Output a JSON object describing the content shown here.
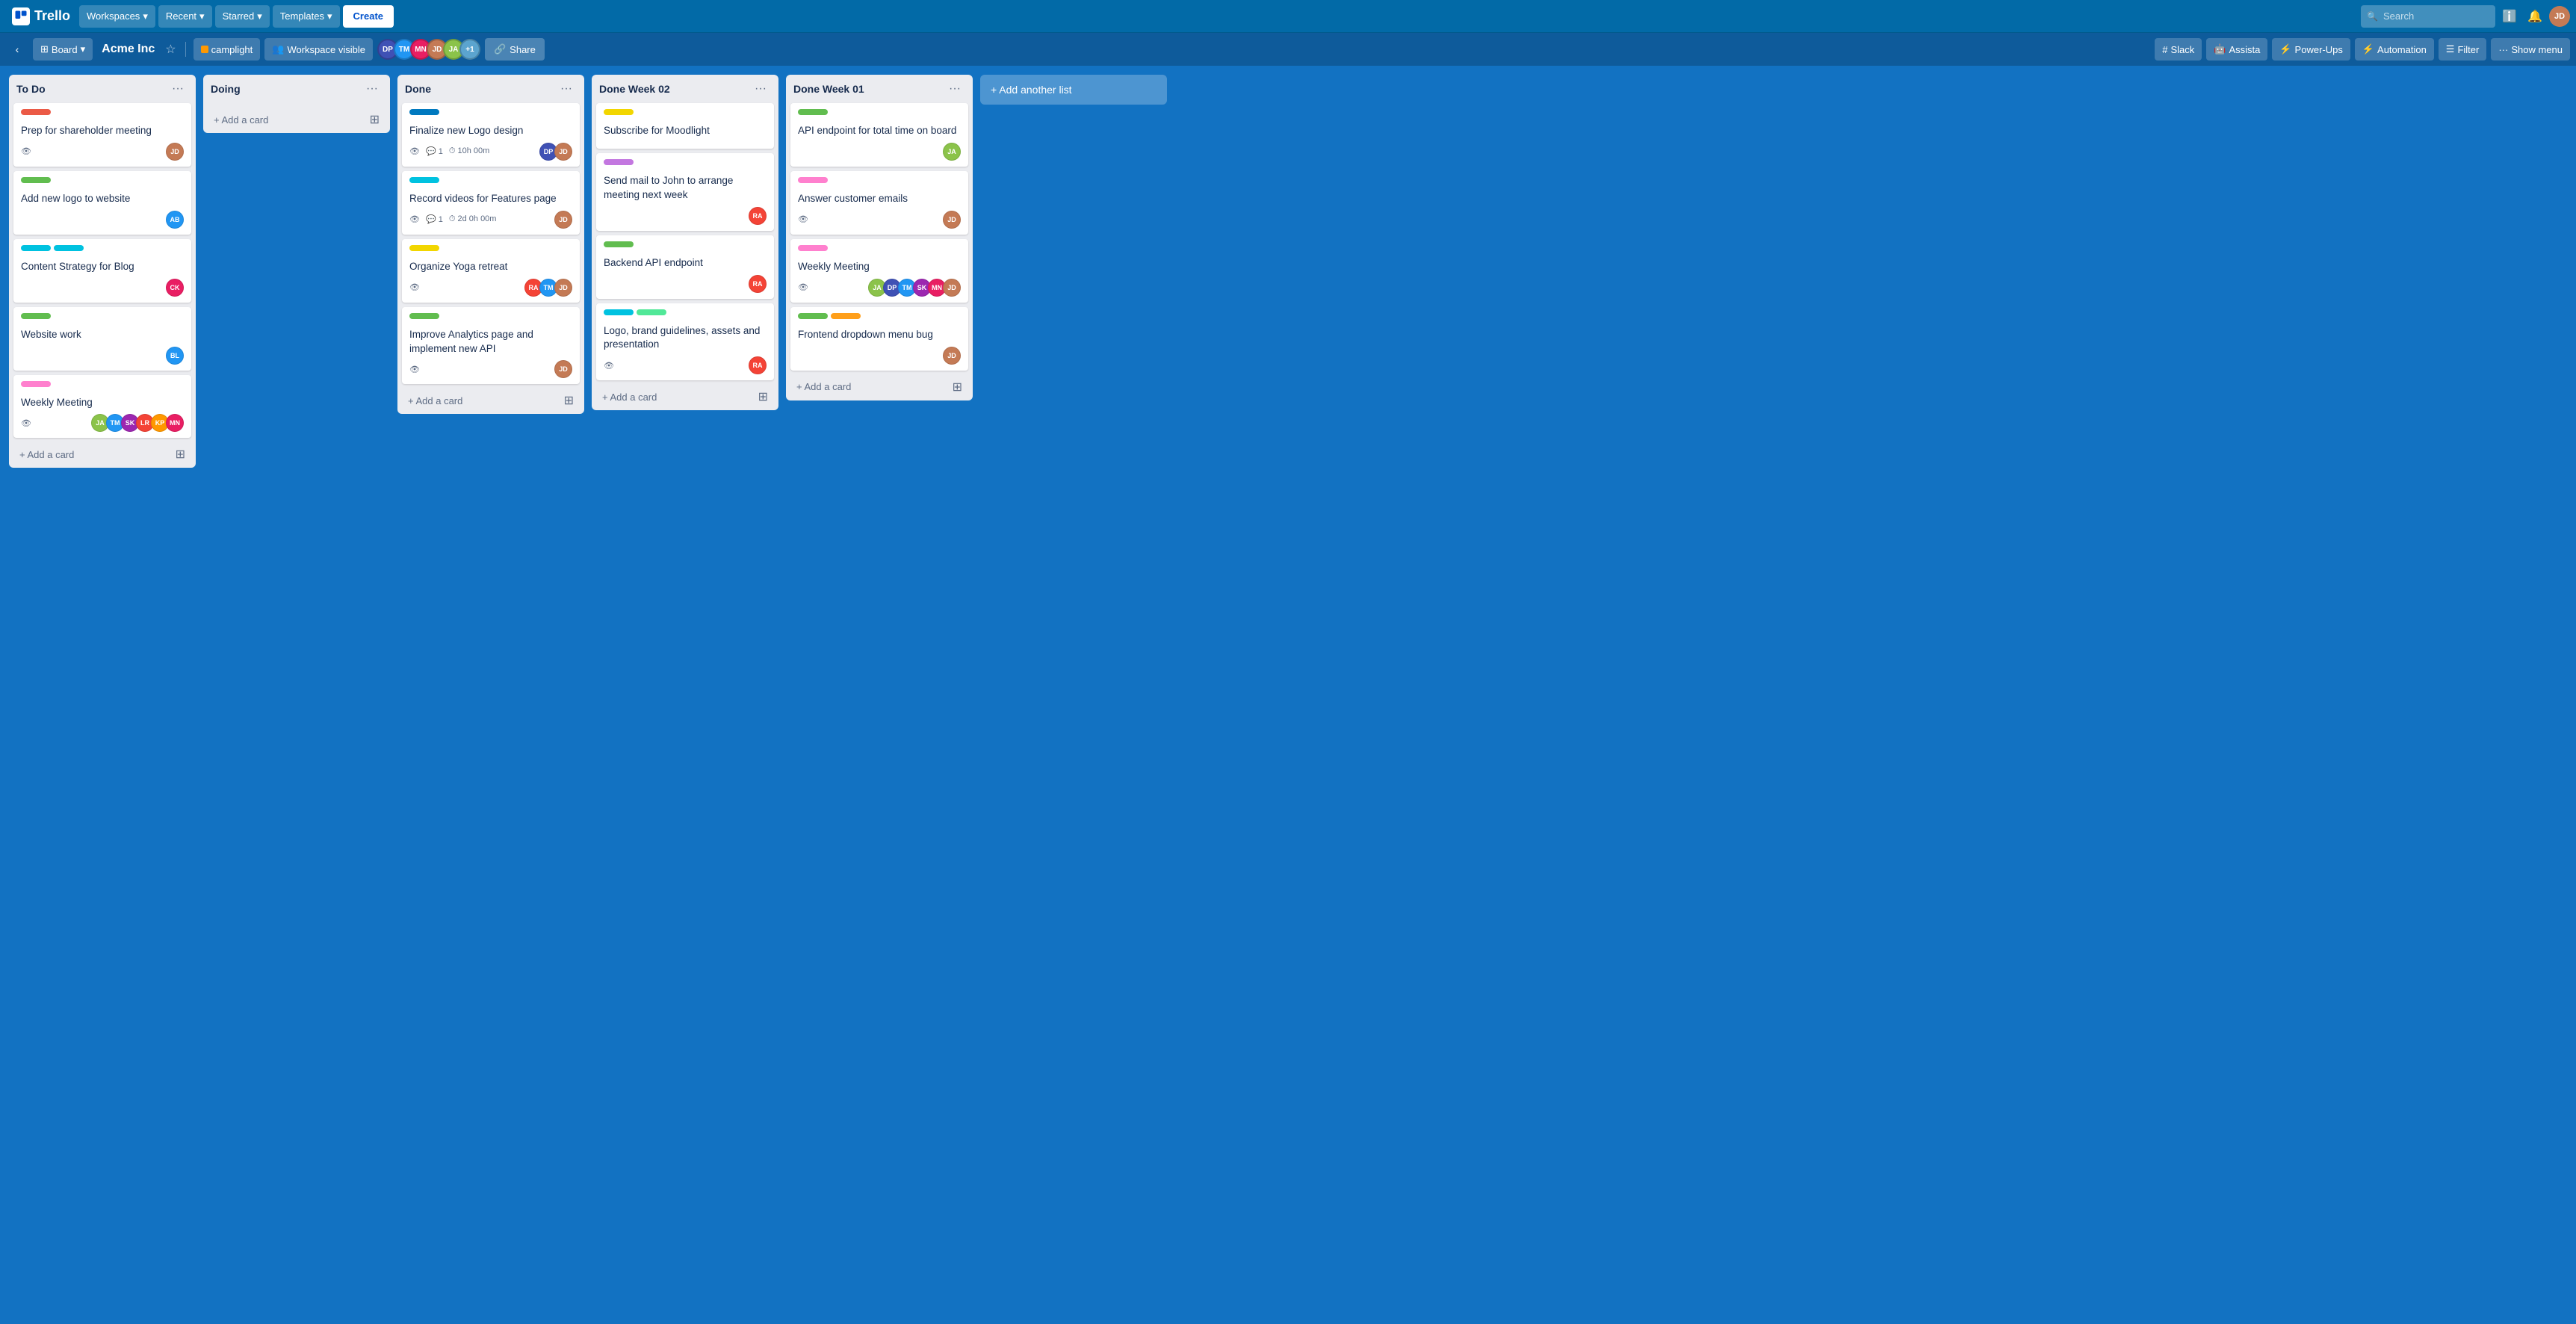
{
  "topNav": {
    "logo": "Trello",
    "workspaces": "Workspaces",
    "recent": "Recent",
    "starred": "Starred",
    "templates": "Templates",
    "create": "Create",
    "search_placeholder": "Search",
    "info_icon": "ℹ",
    "notification_icon": "🔔"
  },
  "boardNav": {
    "board_label": "Board",
    "board_title": "Acme Inc",
    "workspace_label": "camplight",
    "visibility_label": "Workspace visible",
    "share_label": "Share",
    "slack_label": "Slack",
    "assista_label": "Assista",
    "powerups_label": "Power-Ups",
    "automation_label": "Automation",
    "filter_label": "Filter",
    "show_menu_label": "Show menu"
  },
  "lists": [
    {
      "id": "todo",
      "title": "To Do",
      "cards": [
        {
          "id": "c1",
          "label_color": "red",
          "title": "Prep for shareholder meeting",
          "has_eye": true,
          "avatars": [
            {
              "color": "av-brown",
              "initials": "JD"
            }
          ]
        },
        {
          "id": "c2",
          "label_color": "green",
          "title": "Add new logo to website",
          "has_eye": false,
          "avatars": [
            {
              "color": "av-blue",
              "initials": "AB"
            }
          ]
        },
        {
          "id": "c3",
          "labels": [
            "cyan",
            "cyan"
          ],
          "title": "Content Strategy for Blog",
          "has_eye": false,
          "avatars": [
            {
              "color": "av-pink",
              "initials": "CK"
            }
          ]
        },
        {
          "id": "c4",
          "label_color": "green",
          "title": "Website work",
          "has_eye": false,
          "avatars": [
            {
              "color": "av-blue",
              "initials": "BL"
            }
          ]
        },
        {
          "id": "c5",
          "label_color": "pink",
          "title": "Weekly Meeting",
          "has_eye": true,
          "avatars": [
            {
              "color": "av-lime",
              "initials": "JA"
            },
            {
              "color": "av-blue",
              "initials": "TM"
            },
            {
              "color": "av-purple",
              "initials": "SK"
            },
            {
              "color": "av-red",
              "initials": "LR"
            },
            {
              "color": "av-orange",
              "initials": "KP"
            },
            {
              "color": "av-pink",
              "initials": "MN"
            }
          ]
        }
      ],
      "add_card_label": "+ Add a card"
    },
    {
      "id": "doing",
      "title": "Doing",
      "cards": [],
      "add_card_label": "+ Add a card"
    },
    {
      "id": "done",
      "title": "Done",
      "cards": [
        {
          "id": "c6",
          "label_color": "blue",
          "title": "Finalize new Logo design",
          "has_eye": true,
          "comment_count": "1",
          "time_label": "10h 00m",
          "avatars": [
            {
              "color": "av-indigo",
              "initials": "DP"
            },
            {
              "color": "av-brown",
              "initials": "JD"
            }
          ]
        },
        {
          "id": "c7",
          "label_color": "cyan",
          "title": "Record videos for Features page",
          "has_eye": true,
          "comment_count": "1",
          "time_label": "2d 0h 00m",
          "avatars": [
            {
              "color": "av-brown",
              "initials": "JD"
            }
          ]
        },
        {
          "id": "c8",
          "label_color": "yellow",
          "title": "Organize Yoga retreat",
          "has_eye": true,
          "avatars": [
            {
              "color": "av-red",
              "initials": "RA"
            },
            {
              "color": "av-blue",
              "initials": "TM"
            },
            {
              "color": "av-brown",
              "initials": "JD"
            }
          ]
        },
        {
          "id": "c9",
          "label_color": "green",
          "title": "Improve Analytics page and implement new API",
          "has_eye": true,
          "avatars": [
            {
              "color": "av-brown",
              "initials": "JD"
            }
          ]
        }
      ],
      "add_card_label": "+ Add a card"
    },
    {
      "id": "done-week02",
      "title": "Done Week 02",
      "cards": [
        {
          "id": "c10",
          "label_color": "yellow",
          "title": "Subscribe for Moodlight",
          "has_eye": false,
          "avatars": []
        },
        {
          "id": "c11",
          "label_color": "purple",
          "title": "Send mail to John to arrange meeting next week",
          "has_eye": false,
          "avatars": [
            {
              "color": "av-red",
              "initials": "RA"
            }
          ]
        },
        {
          "id": "c12",
          "label_color": "green",
          "title": "Backend API endpoint",
          "has_eye": false,
          "avatars": [
            {
              "color": "av-red",
              "initials": "RA"
            }
          ]
        },
        {
          "id": "c13",
          "labels": [
            "cyan",
            "teal"
          ],
          "title": "Logo, brand guidelines, assets and presentation",
          "has_eye": true,
          "avatars": [
            {
              "color": "av-red",
              "initials": "RA"
            }
          ]
        }
      ],
      "add_card_label": "+ Add a card"
    },
    {
      "id": "done-week01",
      "title": "Done Week 01",
      "cards": [
        {
          "id": "c14",
          "label_color": "green",
          "title": "API endpoint for total time on board",
          "has_eye": false,
          "avatars": [
            {
              "color": "av-lime",
              "initials": "JA"
            }
          ]
        },
        {
          "id": "c15",
          "label_color": "pink",
          "title": "Answer customer emails",
          "has_eye": true,
          "avatars": [
            {
              "color": "av-brown",
              "initials": "JD"
            }
          ]
        },
        {
          "id": "c16",
          "label_color": "pink",
          "title": "Weekly Meeting",
          "has_eye": true,
          "avatars": [
            {
              "color": "av-lime",
              "initials": "JA"
            },
            {
              "color": "av-indigo",
              "initials": "DP"
            },
            {
              "color": "av-blue",
              "initials": "TM"
            },
            {
              "color": "av-purple",
              "initials": "SK"
            },
            {
              "color": "av-pink",
              "initials": "MN"
            },
            {
              "color": "av-brown",
              "initials": "JD"
            }
          ]
        },
        {
          "id": "c17",
          "labels": [
            "green",
            "orange"
          ],
          "title": "Frontend dropdown menu bug",
          "has_eye": false,
          "avatars": [
            {
              "color": "av-brown",
              "initials": "JD"
            }
          ]
        }
      ],
      "add_card_label": "+ Add a card"
    }
  ],
  "addAnotherList": "+ Add another list",
  "boardAvatars": [
    {
      "color": "av-indigo",
      "initials": "DP"
    },
    {
      "color": "av-blue",
      "initials": "TM"
    },
    {
      "color": "av-pink",
      "initials": "MN"
    },
    {
      "color": "av-brown",
      "initials": "JD"
    },
    {
      "color": "av-lime",
      "initials": "JA"
    }
  ],
  "boardAvatarExtra": "+1"
}
